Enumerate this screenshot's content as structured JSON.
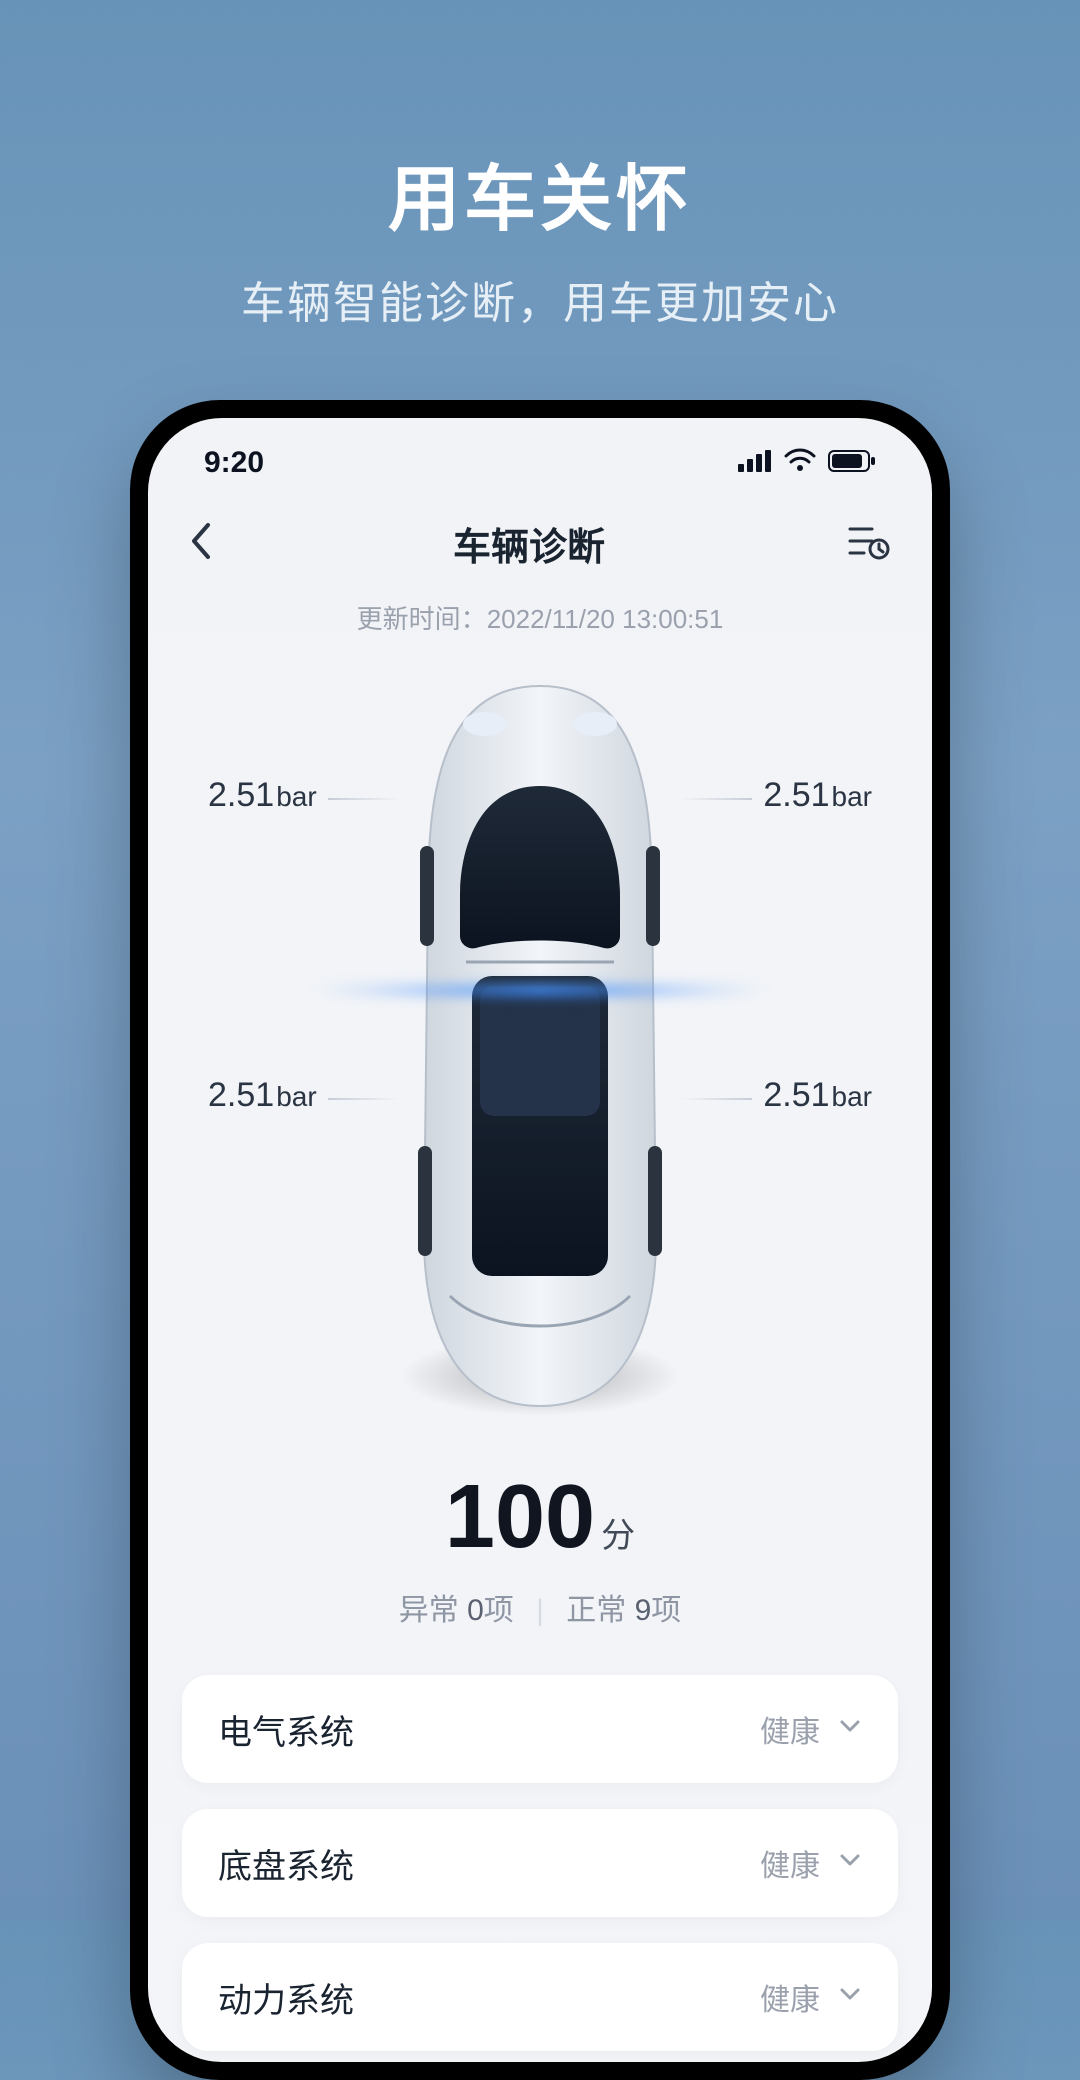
{
  "hero": {
    "title": "用车关怀",
    "subtitle": "车辆智能诊断，用车更加安心"
  },
  "statusbar": {
    "time": "9:20"
  },
  "nav": {
    "title": "车辆诊断"
  },
  "update": {
    "label": "更新时间：",
    "value": "2022/11/20 13:00:51"
  },
  "tires": {
    "fl": {
      "value": "2.51",
      "unit": "bar"
    },
    "fr": {
      "value": "2.51",
      "unit": "bar"
    },
    "rl": {
      "value": "2.51",
      "unit": "bar"
    },
    "rr": {
      "value": "2.51",
      "unit": "bar"
    }
  },
  "score": {
    "value": "100",
    "suffix": "分"
  },
  "counts": {
    "abnormal_label": "异常",
    "abnormal_value": "0",
    "abnormal_unit": "项",
    "normal_label": "正常",
    "normal_value": "9",
    "normal_unit": "项"
  },
  "systems": [
    {
      "name": "电气系统",
      "status": "健康"
    },
    {
      "name": "底盘系统",
      "status": "健康"
    },
    {
      "name": "动力系统",
      "status": "健康"
    }
  ]
}
